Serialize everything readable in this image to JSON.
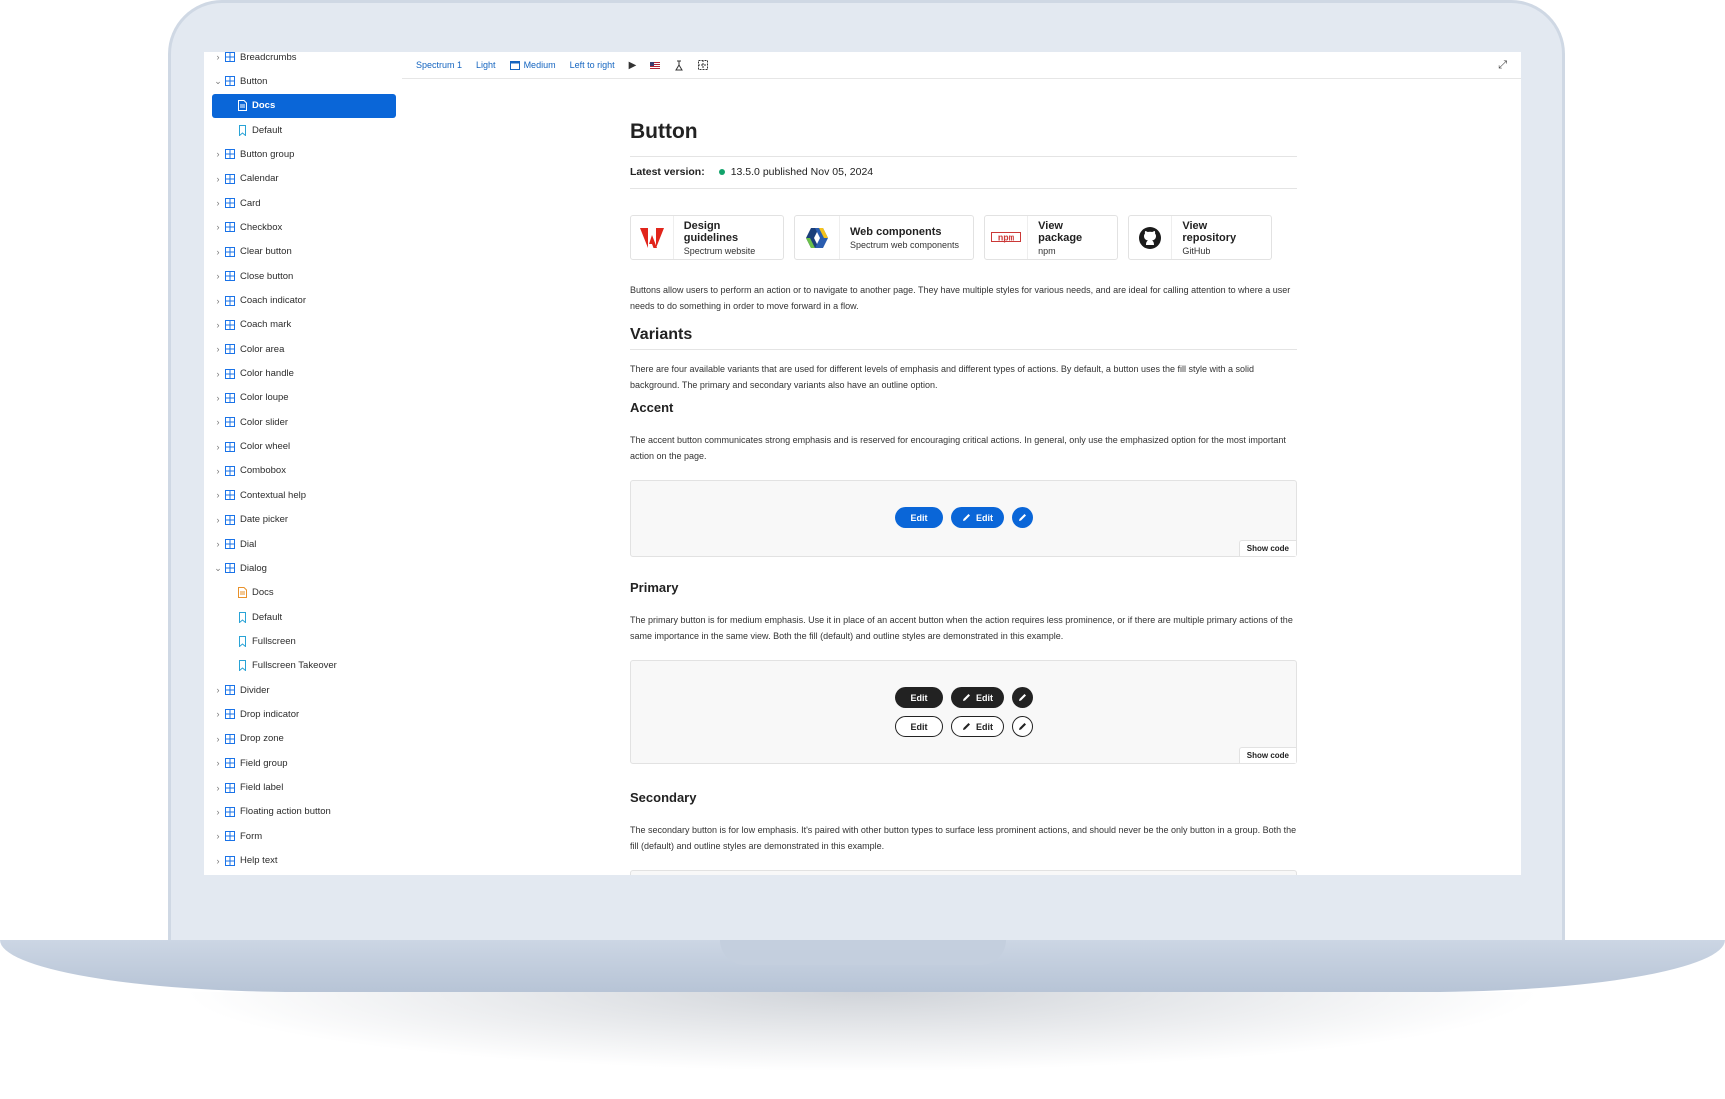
{
  "sidebar": {
    "items": [
      {
        "label": "Breadcrumbs",
        "type": "component",
        "expanded": false,
        "selected": false
      },
      {
        "label": "Button",
        "type": "component",
        "expanded": true,
        "selected": false
      },
      {
        "label": "Docs",
        "type": "docs",
        "child": true,
        "selected": true
      },
      {
        "label": "Default",
        "type": "story",
        "child": true,
        "selected": false
      },
      {
        "label": "Button group",
        "type": "component",
        "expanded": false,
        "selected": false
      },
      {
        "label": "Calendar",
        "type": "component",
        "expanded": false,
        "selected": false
      },
      {
        "label": "Card",
        "type": "component",
        "expanded": false,
        "selected": false
      },
      {
        "label": "Checkbox",
        "type": "component",
        "expanded": false,
        "selected": false
      },
      {
        "label": "Clear button",
        "type": "component",
        "expanded": false,
        "selected": false
      },
      {
        "label": "Close button",
        "type": "component",
        "expanded": false,
        "selected": false
      },
      {
        "label": "Coach indicator",
        "type": "component",
        "expanded": false,
        "selected": false
      },
      {
        "label": "Coach mark",
        "type": "component",
        "expanded": false,
        "selected": false
      },
      {
        "label": "Color area",
        "type": "component",
        "expanded": false,
        "selected": false
      },
      {
        "label": "Color handle",
        "type": "component",
        "expanded": false,
        "selected": false
      },
      {
        "label": "Color loupe",
        "type": "component",
        "expanded": false,
        "selected": false
      },
      {
        "label": "Color slider",
        "type": "component",
        "expanded": false,
        "selected": false
      },
      {
        "label": "Color wheel",
        "type": "component",
        "expanded": false,
        "selected": false
      },
      {
        "label": "Combobox",
        "type": "component",
        "expanded": false,
        "selected": false
      },
      {
        "label": "Contextual help",
        "type": "component",
        "expanded": false,
        "selected": false
      },
      {
        "label": "Date picker",
        "type": "component",
        "expanded": false,
        "selected": false
      },
      {
        "label": "Dial",
        "type": "component",
        "expanded": false,
        "selected": false
      },
      {
        "label": "Dialog",
        "type": "component",
        "expanded": true,
        "selected": false
      },
      {
        "label": "Docs",
        "type": "docs-orange",
        "child": true,
        "selected": false
      },
      {
        "label": "Default",
        "type": "story",
        "child": true,
        "selected": false
      },
      {
        "label": "Fullscreen",
        "type": "story",
        "child": true,
        "selected": false
      },
      {
        "label": "Fullscreen Takeover",
        "type": "story",
        "child": true,
        "selected": false
      },
      {
        "label": "Divider",
        "type": "component",
        "expanded": false,
        "selected": false
      },
      {
        "label": "Drop indicator",
        "type": "component",
        "expanded": false,
        "selected": false
      },
      {
        "label": "Drop zone",
        "type": "component",
        "expanded": false,
        "selected": false
      },
      {
        "label": "Field group",
        "type": "component",
        "expanded": false,
        "selected": false
      },
      {
        "label": "Field label",
        "type": "component",
        "expanded": false,
        "selected": false
      },
      {
        "label": "Floating action button",
        "type": "component",
        "expanded": false,
        "selected": false
      },
      {
        "label": "Form",
        "type": "component",
        "expanded": false,
        "selected": false
      },
      {
        "label": "Help text",
        "type": "component",
        "expanded": false,
        "selected": false
      }
    ]
  },
  "toolbar": {
    "theme": "Spectrum 1",
    "color": "Light",
    "scale": "Medium",
    "direction": "Left to right"
  },
  "doc": {
    "title": "Button",
    "version_label": "Latest version:",
    "version_value": "13.5.0 published Nov 05, 2024",
    "links": [
      {
        "title": "Design guidelines",
        "sub": "Spectrum website",
        "icon": "adobe-logo-icon"
      },
      {
        "title": "Web components",
        "sub": "Spectrum web components",
        "icon": "web-components-logo-icon"
      },
      {
        "title": "View package",
        "sub": "npm",
        "icon": "npm-logo-icon"
      },
      {
        "title": "View repository",
        "sub": "GitHub",
        "icon": "github-logo-icon"
      }
    ],
    "intro": "Buttons allow users to perform an action or to navigate to another page. They have multiple styles for various needs, and are ideal for calling attention to where a user needs to do something in order to move forward in a flow.",
    "variants_heading": "Variants",
    "variants_text": "There are four available variants that are used for different levels of emphasis and different types of actions. By default, a button uses the fill style with a solid background. The primary and secondary variants also have an outline option.",
    "accent_heading": "Accent",
    "accent_text": "The accent button communicates strong emphasis and is reserved for encouraging critical actions. In general, only use the emphasized option for the most important action on the page.",
    "primary_heading": "Primary",
    "primary_text": "The primary button is for medium emphasis. Use it in place of an accent button when the action requires less prominence, or if there are multiple primary actions of the same importance in the same view. Both the fill (default) and outline styles are demonstrated in this example.",
    "secondary_heading": "Secondary",
    "secondary_text": "The secondary button is for low emphasis. It's paired with other button types to surface less prominent actions, and should never be the only button in a group. Both the fill (default) and outline styles are demonstrated in this example.",
    "button_label": "Edit",
    "show_code": "Show code"
  },
  "colors": {
    "accent": "#0a66d8",
    "primary": "#222222",
    "status_green": "#12a36b",
    "link_blue": "#1565c0"
  }
}
